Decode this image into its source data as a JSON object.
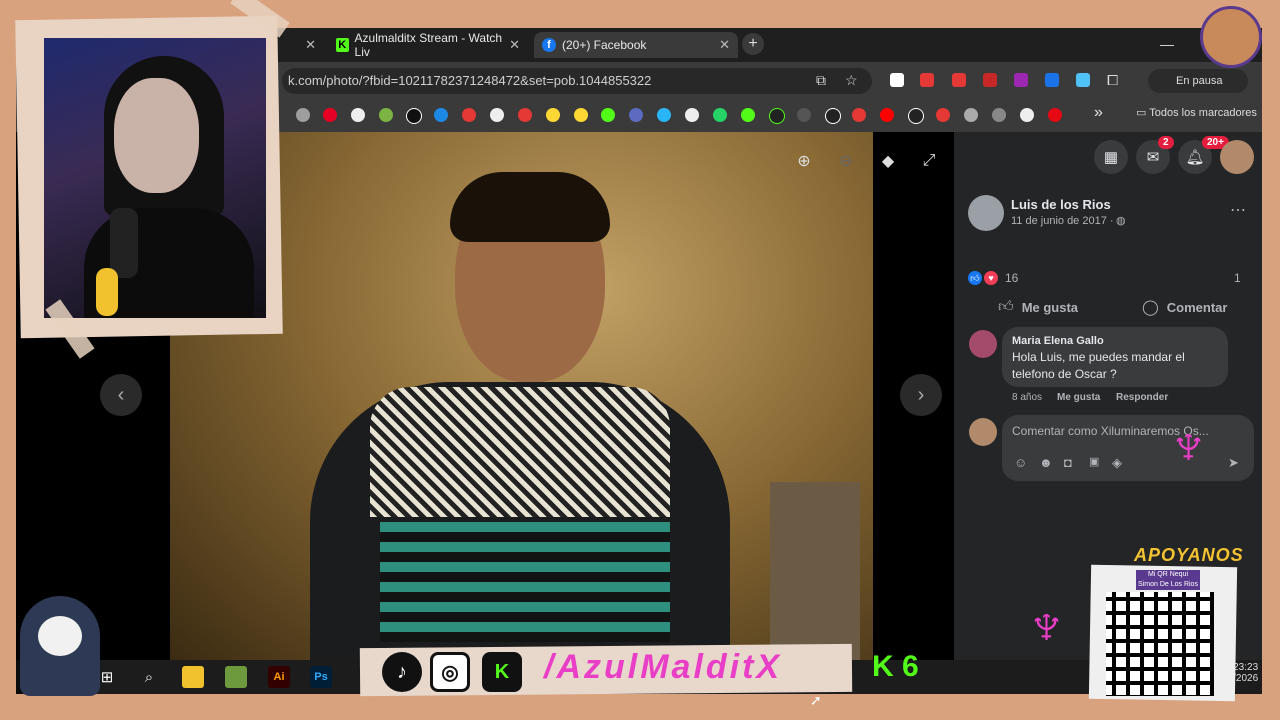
{
  "browser": {
    "tabs": [
      {
        "label": "",
        "favicon": "generic-icon"
      },
      {
        "label": "Azulmalditx Stream - Watch Liv",
        "favicon": "kick-icon"
      },
      {
        "label": "(20+) Facebook",
        "favicon": "facebook-icon"
      }
    ],
    "url": "k.com/photo/?fbid=10211782371248472&set=pob.1044855322",
    "profile_status": "En pausa",
    "bookmarks_folder": "Todos los marcadores",
    "bookmark_overflow": "»"
  },
  "facebook": {
    "messenger_badge": "2",
    "notifications_badge": "20+",
    "post": {
      "author": "Luis de los Rios",
      "date": "11 de junio de 2017 ·",
      "reaction_count": "16",
      "comment_count": "1",
      "like_label": "Me gusta",
      "comment_label": "Comentar"
    },
    "comment": {
      "author": "Maria Elena Gallo",
      "text_line1": "Hola Luis, me puedes mandar el",
      "text_line2": "telefono de Oscar ?",
      "age": "8 años",
      "like": "Me gusta",
      "reply": "Responder"
    },
    "compose_placeholder": "Comentar como Xiluminaremos Os..."
  },
  "overlay": {
    "handle": "/AzulMalditX",
    "kick_badge": "K 6",
    "support_title": "APOYANOS",
    "qr_caption_line1": "Mi QR Nequi",
    "qr_caption_line2": "Simon De Los Rios"
  },
  "taskbar": {
    "time": "23:23",
    "date": "03/2026"
  },
  "colors": {
    "paper": "#d9a27f",
    "facebook_blue": "#1877f2",
    "kick_green": "#53fc18",
    "accent_pink": "#e93ec6",
    "notification_red": "#e41e3f"
  }
}
